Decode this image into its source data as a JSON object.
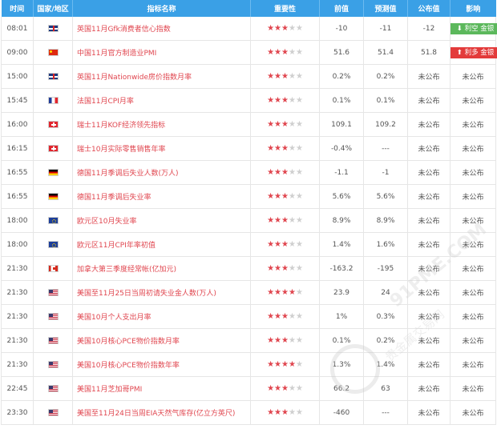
{
  "headers": [
    "时间",
    "国家/地区",
    "指标名称",
    "重要性",
    "前值",
    "预测值",
    "公布值",
    "影响"
  ],
  "rows": [
    {
      "time": "08:01",
      "flag": "uk",
      "indicator": "英国11月Gfk消费者信心指数",
      "stars": 3,
      "prev": "-10",
      "forecast": "-11",
      "actual": "-12",
      "impact": "利空 金银",
      "impact_type": "bearish"
    },
    {
      "time": "09:00",
      "flag": "cn",
      "indicator": "中国11月官方制造业PMI",
      "stars": 3,
      "prev": "51.6",
      "forecast": "51.4",
      "actual": "51.8",
      "impact": "利多 金银",
      "impact_type": "bullish"
    },
    {
      "time": "15:00",
      "flag": "uk",
      "indicator": "英国11月Nationwide房价指数月率",
      "stars": 3,
      "prev": "0.2%",
      "forecast": "0.2%",
      "actual": "未公布",
      "impact": "未公布",
      "impact_type": "none"
    },
    {
      "time": "15:45",
      "flag": "fr",
      "indicator": "法国11月CPI月率",
      "stars": 3,
      "prev": "0.1%",
      "forecast": "0.1%",
      "actual": "未公布",
      "impact": "未公布",
      "impact_type": "none"
    },
    {
      "time": "16:00",
      "flag": "ch",
      "indicator": "瑞士11月KOF经济领先指标",
      "stars": 3,
      "prev": "109.1",
      "forecast": "109.2",
      "actual": "未公布",
      "impact": "未公布",
      "impact_type": "none"
    },
    {
      "time": "16:15",
      "flag": "ch",
      "indicator": "瑞士10月实际零售销售年率",
      "stars": 3,
      "prev": "-0.4%",
      "forecast": "---",
      "actual": "未公布",
      "impact": "未公布",
      "impact_type": "none"
    },
    {
      "time": "16:55",
      "flag": "de",
      "indicator": "德国11月季调后失业人数(万人)",
      "stars": 3,
      "prev": "-1.1",
      "forecast": "-1",
      "actual": "未公布",
      "impact": "未公布",
      "impact_type": "none"
    },
    {
      "time": "16:55",
      "flag": "de",
      "indicator": "德国11月季调后失业率",
      "stars": 3,
      "prev": "5.6%",
      "forecast": "5.6%",
      "actual": "未公布",
      "impact": "未公布",
      "impact_type": "none"
    },
    {
      "time": "18:00",
      "flag": "eu",
      "indicator": "欧元区10月失业率",
      "stars": 3,
      "prev": "8.9%",
      "forecast": "8.9%",
      "actual": "未公布",
      "impact": "未公布",
      "impact_type": "none"
    },
    {
      "time": "18:00",
      "flag": "eu",
      "indicator": "欧元区11月CPI年率初值",
      "stars": 3,
      "prev": "1.4%",
      "forecast": "1.6%",
      "actual": "未公布",
      "impact": "未公布",
      "impact_type": "none"
    },
    {
      "time": "21:30",
      "flag": "ca",
      "indicator": "加拿大第三季度经常帐(亿加元)",
      "stars": 3,
      "prev": "-163.2",
      "forecast": "-195",
      "actual": "未公布",
      "impact": "未公布",
      "impact_type": "none"
    },
    {
      "time": "21:30",
      "flag": "us",
      "indicator": "美国至11月25日当周初请失业金人数(万人)",
      "stars": 4,
      "prev": "23.9",
      "forecast": "24",
      "actual": "未公布",
      "impact": "未公布",
      "impact_type": "none"
    },
    {
      "time": "21:30",
      "flag": "us",
      "indicator": "美国10月个人支出月率",
      "stars": 3,
      "prev": "1%",
      "forecast": "0.3%",
      "actual": "未公布",
      "impact": "未公布",
      "impact_type": "none"
    },
    {
      "time": "21:30",
      "flag": "us",
      "indicator": "美国10月核心PCE物价指数月率",
      "stars": 3,
      "prev": "0.1%",
      "forecast": "0.2%",
      "actual": "未公布",
      "impact": "未公布",
      "impact_type": "none"
    },
    {
      "time": "21:30",
      "flag": "us",
      "indicator": "美国10月核心PCE物价指数年率",
      "stars": 4,
      "prev": "1.3%",
      "forecast": "1.4%",
      "actual": "未公布",
      "impact": "未公布",
      "impact_type": "none"
    },
    {
      "time": "22:45",
      "flag": "us",
      "indicator": "美国11月芝加哥PMI",
      "stars": 3,
      "prev": "66.2",
      "forecast": "63",
      "actual": "未公布",
      "impact": "未公布",
      "impact_type": "none"
    },
    {
      "time": "23:30",
      "flag": "us",
      "indicator": "美国至11月24日当周EIA天然气库存(亿立方英尺)",
      "stars": 3,
      "prev": "-460",
      "forecast": "---",
      "actual": "未公布",
      "impact": "未公布",
      "impact_type": "none"
    }
  ],
  "watermark": {
    "line1": "91PME.COM",
    "line2": "贵金属交易网"
  },
  "colors": {
    "header_bg": "#3aa0e6",
    "indicator_text": "#e0464f",
    "star_on": "#e0464f",
    "star_off": "#cfcfcf",
    "bearish": "#5cb85c",
    "bullish": "#e33b3b"
  }
}
